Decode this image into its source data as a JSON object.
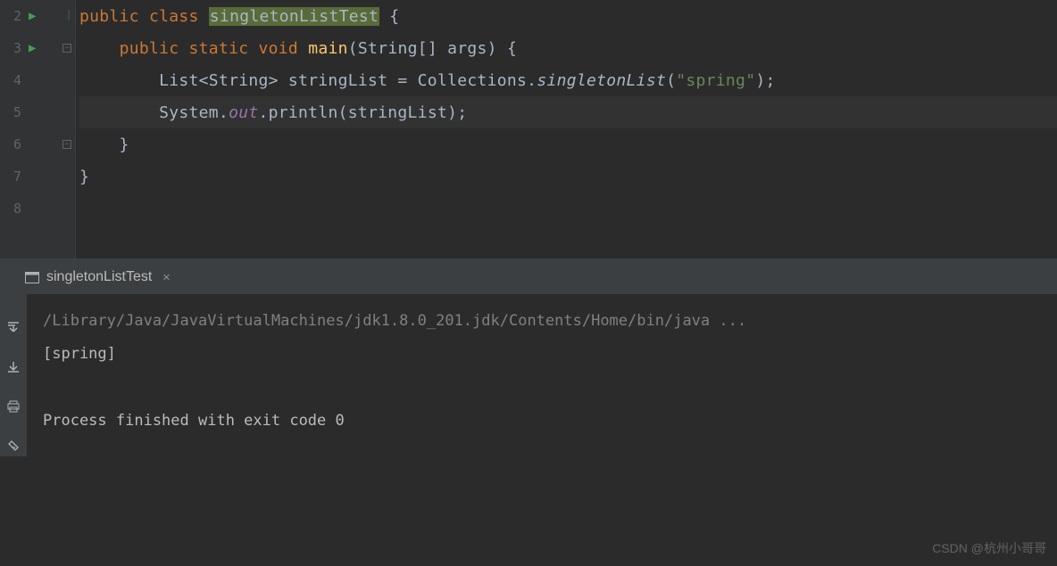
{
  "editor": {
    "lines": {
      "l2": "2",
      "l3": "3",
      "l4": "4",
      "l5": "5",
      "l6": "6",
      "l7": "7",
      "l8": "8"
    },
    "code": {
      "kw_public1": "public",
      "kw_class": "class",
      "class_name": "singletonListTest",
      "brace_open1": " {",
      "kw_public2": "public",
      "kw_static": "static",
      "kw_void": "void",
      "method_main": "main",
      "main_params": "(String[] args) {",
      "list_decl": "List<String> stringList = Collections.",
      "singleton_list": "singletonList",
      "sl_args": "(",
      "str_spring": "\"spring\"",
      "sl_end": ");",
      "system": "System.",
      "out": "out",
      "println": ".println(stringList);",
      "brace_close_inner": "    }",
      "brace_close_outer": "}"
    }
  },
  "console": {
    "tab_label": "singletonListTest",
    "output": {
      "path": "/Library/Java/JavaVirtualMachines/jdk1.8.0_201.jdk/Contents/Home/bin/java ...",
      "result": "[spring]",
      "exit": "Process finished with exit code 0"
    }
  },
  "watermark": "CSDN @杭州小哥哥"
}
